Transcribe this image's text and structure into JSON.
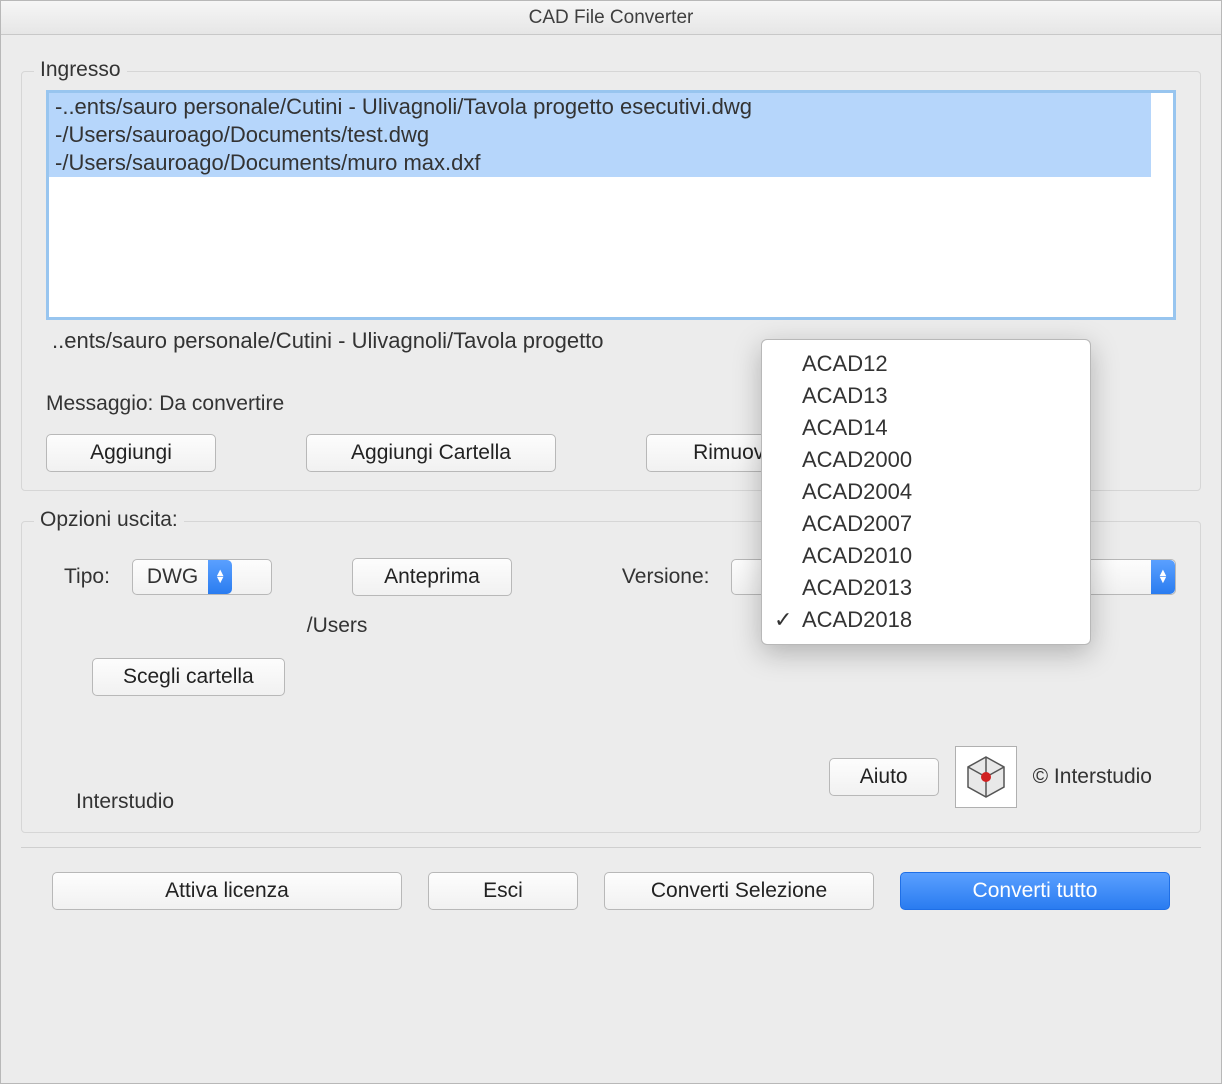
{
  "title": "CAD File Converter",
  "ingresso": {
    "label": "Ingresso",
    "files": [
      "-..ents/sauro personale/Cutini - Ulivagnoli/Tavola progetto esecutivi.dwg",
      "-/Users/sauroago/Documents/test.dwg",
      "-/Users/sauroago/Documents/muro max.dxf"
    ],
    "selected_path": "..ents/sauro personale/Cutini - Ulivagnoli/Tavola progetto",
    "message_prefix": "Messaggio:",
    "message": "Da convertire",
    "btn_add": "Aggiungi",
    "btn_add_folder": "Aggiungi Cartella",
    "btn_remove": "Rimuovi"
  },
  "uscita": {
    "label": "Opzioni uscita:",
    "tipo_label": "Tipo:",
    "tipo_value": "DWG",
    "anteprima": "Anteprima",
    "versione_label": "Versione:",
    "versione_selected": "ACAD2018",
    "versione_options": [
      "ACAD12",
      "ACAD13",
      "ACAD14",
      "ACAD2000",
      "ACAD2004",
      "ACAD2007",
      "ACAD2010",
      "ACAD2013",
      "ACAD2018"
    ],
    "folder_btn": "Scegli cartella",
    "folder_path": "/Users"
  },
  "footer": {
    "aiuto": "Aiuto",
    "copyright": "© Interstudio",
    "vendor": "Interstudio",
    "attiva": "Attiva licenza",
    "esci": "Esci",
    "converti_sel": "Converti Selezione",
    "converti_tutto": "Converti tutto"
  }
}
